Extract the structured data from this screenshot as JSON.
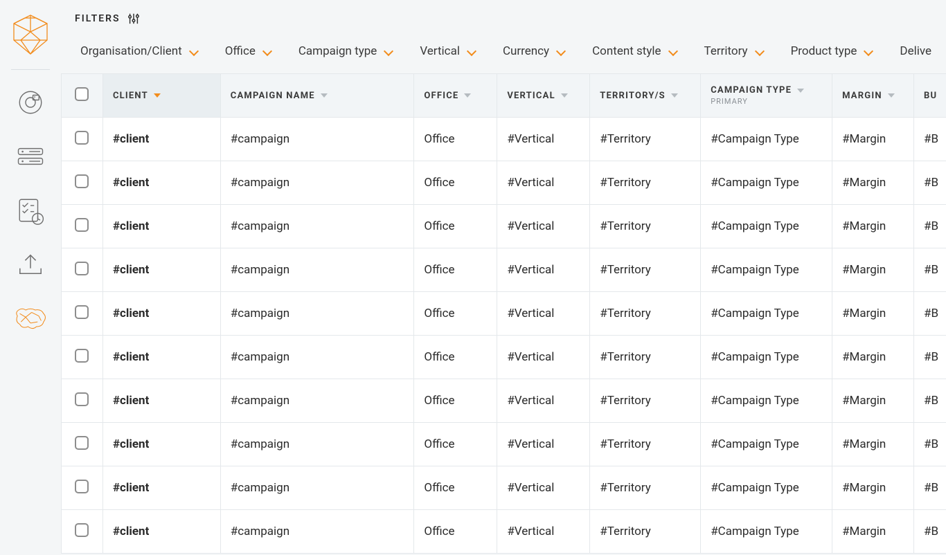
{
  "filters_label": "FILTERS",
  "filter_chips": [
    {
      "label": "Organisation/Client"
    },
    {
      "label": "Office"
    },
    {
      "label": "Campaign type"
    },
    {
      "label": "Vertical"
    },
    {
      "label": "Currency"
    },
    {
      "label": "Content style"
    },
    {
      "label": "Territory"
    },
    {
      "label": "Product type"
    },
    {
      "label": "Deliverabl"
    }
  ],
  "columns": {
    "client": "CLIENT",
    "campaign": "CAMPAIGN NAME",
    "office": "OFFICE",
    "vertical": "VERTICAL",
    "territory": "TERRITORY/S",
    "ctype": "CAMPAIGN TYPE",
    "ctype_sub": "PRIMARY",
    "margin": "MARGIN",
    "budget": "BU"
  },
  "rows": [
    {
      "client": "#client",
      "campaign": "#campaign",
      "office": "Office",
      "vertical": "#Vertical",
      "territory": "#Territory",
      "ctype": "#Campaign Type",
      "margin": "#Margin",
      "budget": "#B"
    },
    {
      "client": "#client",
      "campaign": "#campaign",
      "office": "Office",
      "vertical": "#Vertical",
      "territory": "#Territory",
      "ctype": "#Campaign Type",
      "margin": "#Margin",
      "budget": "#B"
    },
    {
      "client": "#client",
      "campaign": "#campaign",
      "office": "Office",
      "vertical": "#Vertical",
      "territory": "#Territory",
      "ctype": "#Campaign Type",
      "margin": "#Margin",
      "budget": "#B"
    },
    {
      "client": "#client",
      "campaign": "#campaign",
      "office": "Office",
      "vertical": "#Vertical",
      "territory": "#Territory",
      "ctype": "#Campaign Type",
      "margin": "#Margin",
      "budget": "#B"
    },
    {
      "client": "#client",
      "campaign": "#campaign",
      "office": "Office",
      "vertical": "#Vertical",
      "territory": "#Territory",
      "ctype": "#Campaign Type",
      "margin": "#Margin",
      "budget": "#B"
    },
    {
      "client": "#client",
      "campaign": "#campaign",
      "office": "Office",
      "vertical": "#Vertical",
      "territory": "#Territory",
      "ctype": "#Campaign Type",
      "margin": "#Margin",
      "budget": "#B"
    },
    {
      "client": "#client",
      "campaign": "#campaign",
      "office": "Office",
      "vertical": "#Vertical",
      "territory": "#Territory",
      "ctype": "#Campaign Type",
      "margin": "#Margin",
      "budget": "#B"
    },
    {
      "client": "#client",
      "campaign": "#campaign",
      "office": "Office",
      "vertical": "#Vertical",
      "territory": "#Territory",
      "ctype": "#Campaign Type",
      "margin": "#Margin",
      "budget": "#B"
    },
    {
      "client": "#client",
      "campaign": "#campaign",
      "office": "Office",
      "vertical": "#Vertical",
      "territory": "#Territory",
      "ctype": "#Campaign Type",
      "margin": "#Margin",
      "budget": "#B"
    },
    {
      "client": "#client",
      "campaign": "#campaign",
      "office": "Office",
      "vertical": "#Vertical",
      "territory": "#Territory",
      "ctype": "#Campaign Type",
      "margin": "#Margin",
      "budget": "#B"
    }
  ]
}
